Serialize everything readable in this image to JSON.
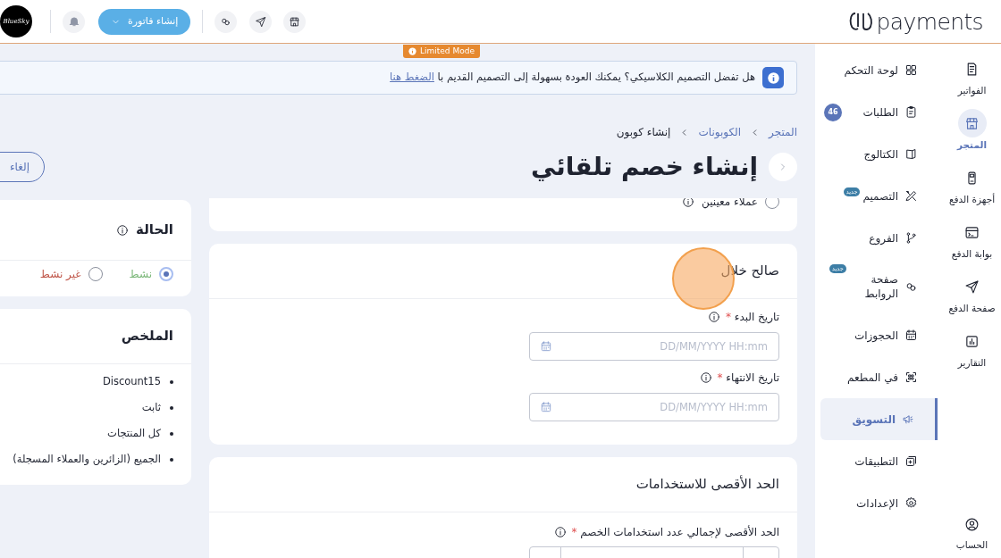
{
  "topbar": {
    "avatar_text": "BlueSky",
    "create_invoice_button": "إنشاء فاتورة",
    "logo_text": "payments"
  },
  "limited_mode_badge": "Limited Mode",
  "banner": {
    "text": "هل تفضل التصميم الكلاسيكي؟ يمكنك العودة بسهولة إلى التصميم القديم با",
    "link": "الضغط هنا"
  },
  "rail": [
    {
      "label": "الفواتير",
      "selected": false
    },
    {
      "label": "المتجر",
      "selected": true
    },
    {
      "label": "أجهزة الدفع",
      "selected": false
    },
    {
      "label": "بوابة الدفع",
      "selected": false
    },
    {
      "label": "صفحة الدفع",
      "selected": false
    },
    {
      "label": "التقارير",
      "selected": false
    }
  ],
  "account": {
    "label": "الحساب"
  },
  "sidebar": [
    {
      "label": "لوحة التحكم",
      "selected": false
    },
    {
      "label": "الطلبات",
      "selected": false,
      "badge": {
        "kind": "count",
        "text": "46"
      }
    },
    {
      "label": "الكتالوج",
      "selected": false
    },
    {
      "label": "التصميم",
      "selected": false,
      "badge": {
        "kind": "new",
        "text": "جديد"
      }
    },
    {
      "label": "الفروع",
      "selected": false
    },
    {
      "label": "صفحة الروابط",
      "selected": false,
      "badge": {
        "kind": "new",
        "text": "جديد"
      }
    },
    {
      "label": "الحجوزات",
      "selected": false
    },
    {
      "label": "في المطعم",
      "selected": false
    },
    {
      "label": "التسويق",
      "selected": true
    },
    {
      "label": "التطبيقات",
      "selected": false
    },
    {
      "label": "الإعدادات",
      "selected": false
    }
  ],
  "breadcrumb": [
    {
      "label": "المتجر",
      "current": false
    },
    {
      "label": "الكوبونات",
      "current": false
    },
    {
      "label": "إنشاء كوبون",
      "current": true
    }
  ],
  "page_title": "إنشاء خصم تلقائي",
  "cancel_button": "إلغاء",
  "customer_option": {
    "label": "عملاء معينين",
    "selected": false
  },
  "validity": {
    "title": "صالح خلال",
    "fields": [
      {
        "label": "تاريخ البدء",
        "required_mark": "*",
        "placeholder": "DD/MM/YYYY HH:mm"
      },
      {
        "label": "تاريخ الانتهاء",
        "required_mark": "*",
        "placeholder": "DD/MM/YYYY HH:mm"
      }
    ]
  },
  "usage_limit": {
    "title": "الحد الأقصى للاستخدامات",
    "field": {
      "label": "الحد الأقصى لإجمالي عدد استخدامات الخصم",
      "required_mark": "*"
    }
  },
  "status": {
    "title": "الحالة",
    "options": [
      {
        "label": "نشط",
        "selected": true,
        "color": "#7cb87a"
      },
      {
        "label": "غير نشط",
        "selected": false,
        "color": "#c0574a"
      }
    ]
  },
  "summary": {
    "title": "الملخص",
    "items": [
      "Discount15",
      "ثابت",
      "كل المنتجات",
      "الجميع (الزائرين والعملاء المسجلة)"
    ]
  }
}
